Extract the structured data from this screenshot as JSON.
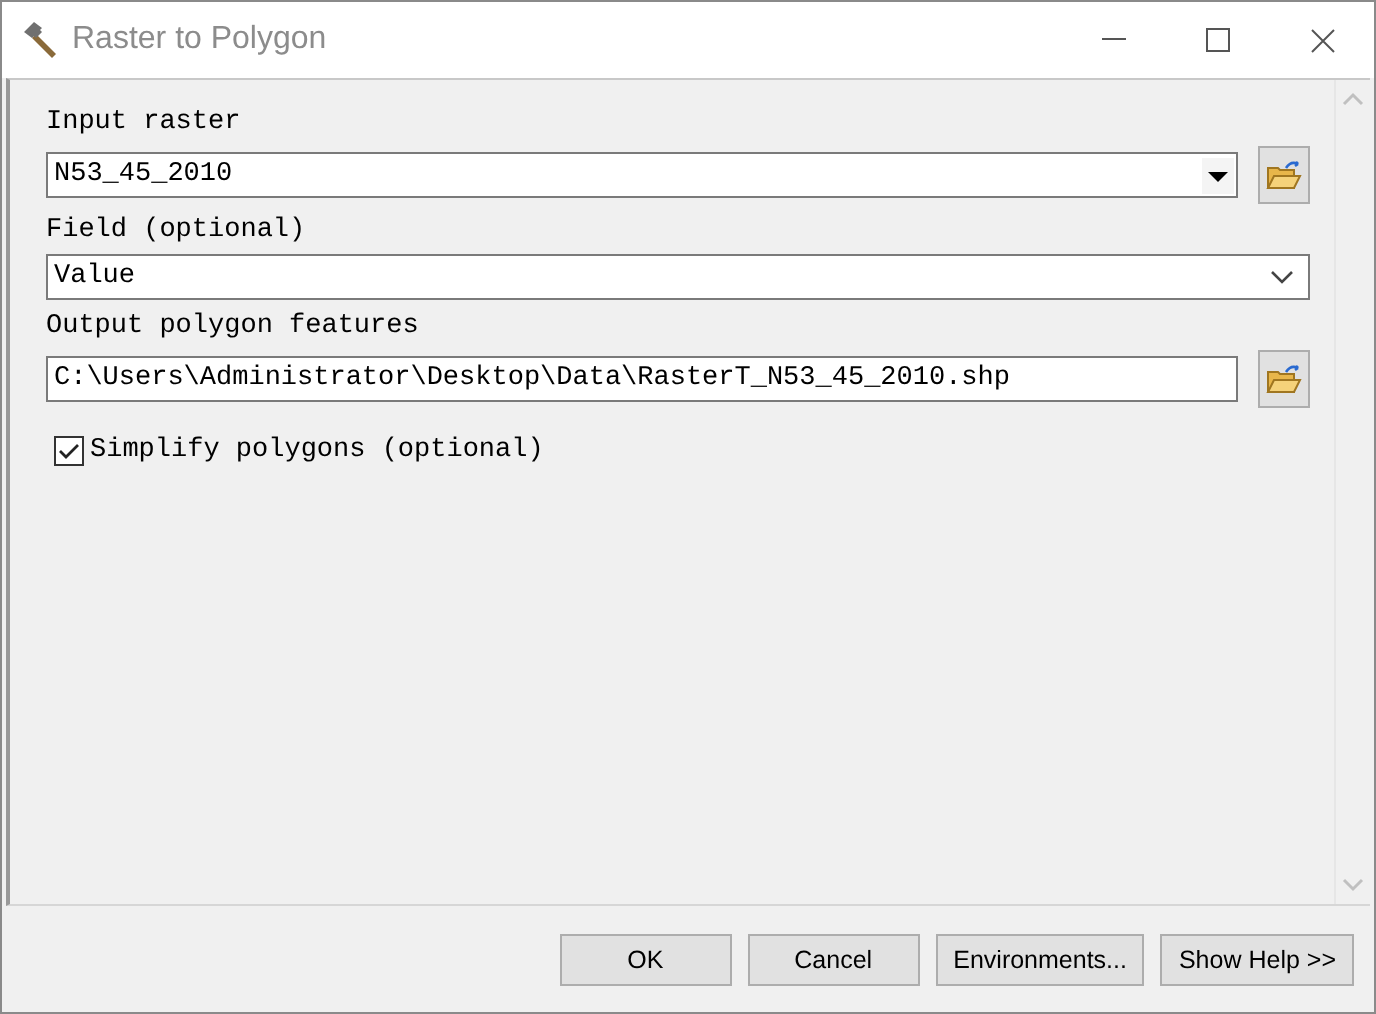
{
  "window": {
    "title": "Raster to Polygon"
  },
  "parameters": [
    {
      "kind": "combo-browse",
      "label": "Input raster",
      "value": "N53_45_2010"
    },
    {
      "kind": "dropdown",
      "label": "Field (optional)",
      "value": "Value"
    },
    {
      "kind": "text-browse",
      "label": "Output polygon features",
      "value": "C:\\Users\\Administrator\\Desktop\\Data\\RasterT_N53_45_2010.shp"
    },
    {
      "kind": "checkbox",
      "label": "Simplify polygons (optional)",
      "checked": true
    }
  ],
  "buttons": [
    "OK",
    "Cancel",
    "Environments...",
    "Show Help >>"
  ]
}
